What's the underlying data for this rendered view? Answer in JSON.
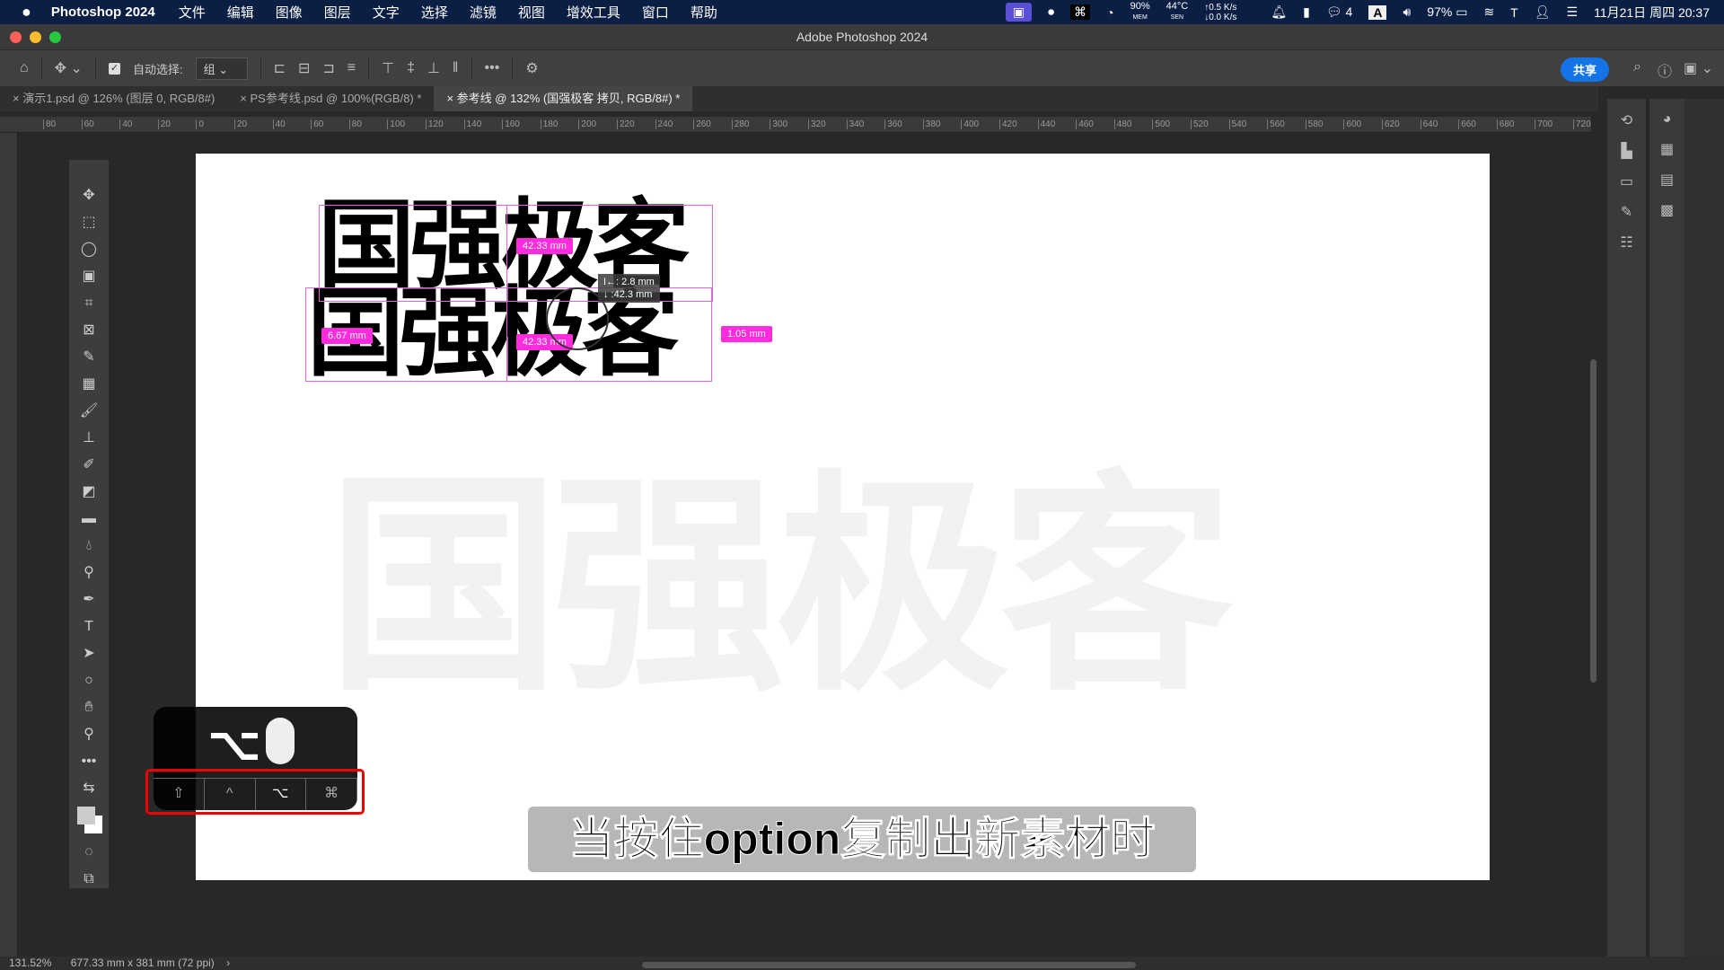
{
  "menubar": {
    "app": "Photoshop 2024",
    "items": [
      "文件",
      "编辑",
      "图像",
      "图层",
      "文字",
      "选择",
      "滤镜",
      "视图",
      "增效工具",
      "窗口",
      "帮助"
    ],
    "status": {
      "mem": "90%",
      "mem_label": "MEM",
      "temp": "44°C",
      "temp_label": "SEN",
      "up": "↑0.5 K/s",
      "down": "↓0.0 K/s",
      "wechat_count": "4",
      "input": "A",
      "battery": "97%",
      "datetime": "11月21日 周四 20:37"
    }
  },
  "window": {
    "title": "Adobe Photoshop 2024"
  },
  "options": {
    "auto_select_label": "自动选择:",
    "auto_select_value": "组",
    "share": "共享"
  },
  "tabs": [
    {
      "label": "演示1.psd @ 126% (图层 0, RGB/8#)"
    },
    {
      "label": "PS参考线.psd @ 100%(RGB/8) *"
    },
    {
      "label": "参考线 @ 132% (国强极客 拷贝, RGB/8#) *"
    }
  ],
  "ruler": {
    "labels": [
      "80",
      "60",
      "40",
      "20",
      "0",
      "20",
      "40",
      "60",
      "80",
      "100",
      "120",
      "140",
      "160",
      "180",
      "200",
      "220",
      "240",
      "260",
      "280",
      "300",
      "320",
      "340",
      "360",
      "380",
      "400",
      "420",
      "440",
      "460",
      "480",
      "500",
      "520",
      "540",
      "560",
      "580",
      "600",
      "620",
      "640",
      "660",
      "680",
      "700",
      "720"
    ]
  },
  "canvas": {
    "text": "国强极客",
    "measure": {
      "top_width": "42.33 mm",
      "bottom_width": "42.33 mm",
      "left_gap": "6.67 mm",
      "right_gap": "1.05 mm",
      "tooltip_dx": "I←:  2.8 mm",
      "tooltip_dy": "↓ :42.3 mm"
    }
  },
  "key_overlay": {
    "main": "⌥",
    "keys": [
      "⇧",
      "^",
      "⌥",
      "⌘"
    ]
  },
  "subtitle": "当按住option复制出新素材时",
  "statusbar": {
    "zoom": "131.52%",
    "doc": "677.33 mm x 381 mm (72 ppi)"
  },
  "colors": {
    "menubar": "#0b1f45",
    "accent": "#1473e6",
    "measure": "#ff2bdc",
    "highlight": "#e00000"
  }
}
